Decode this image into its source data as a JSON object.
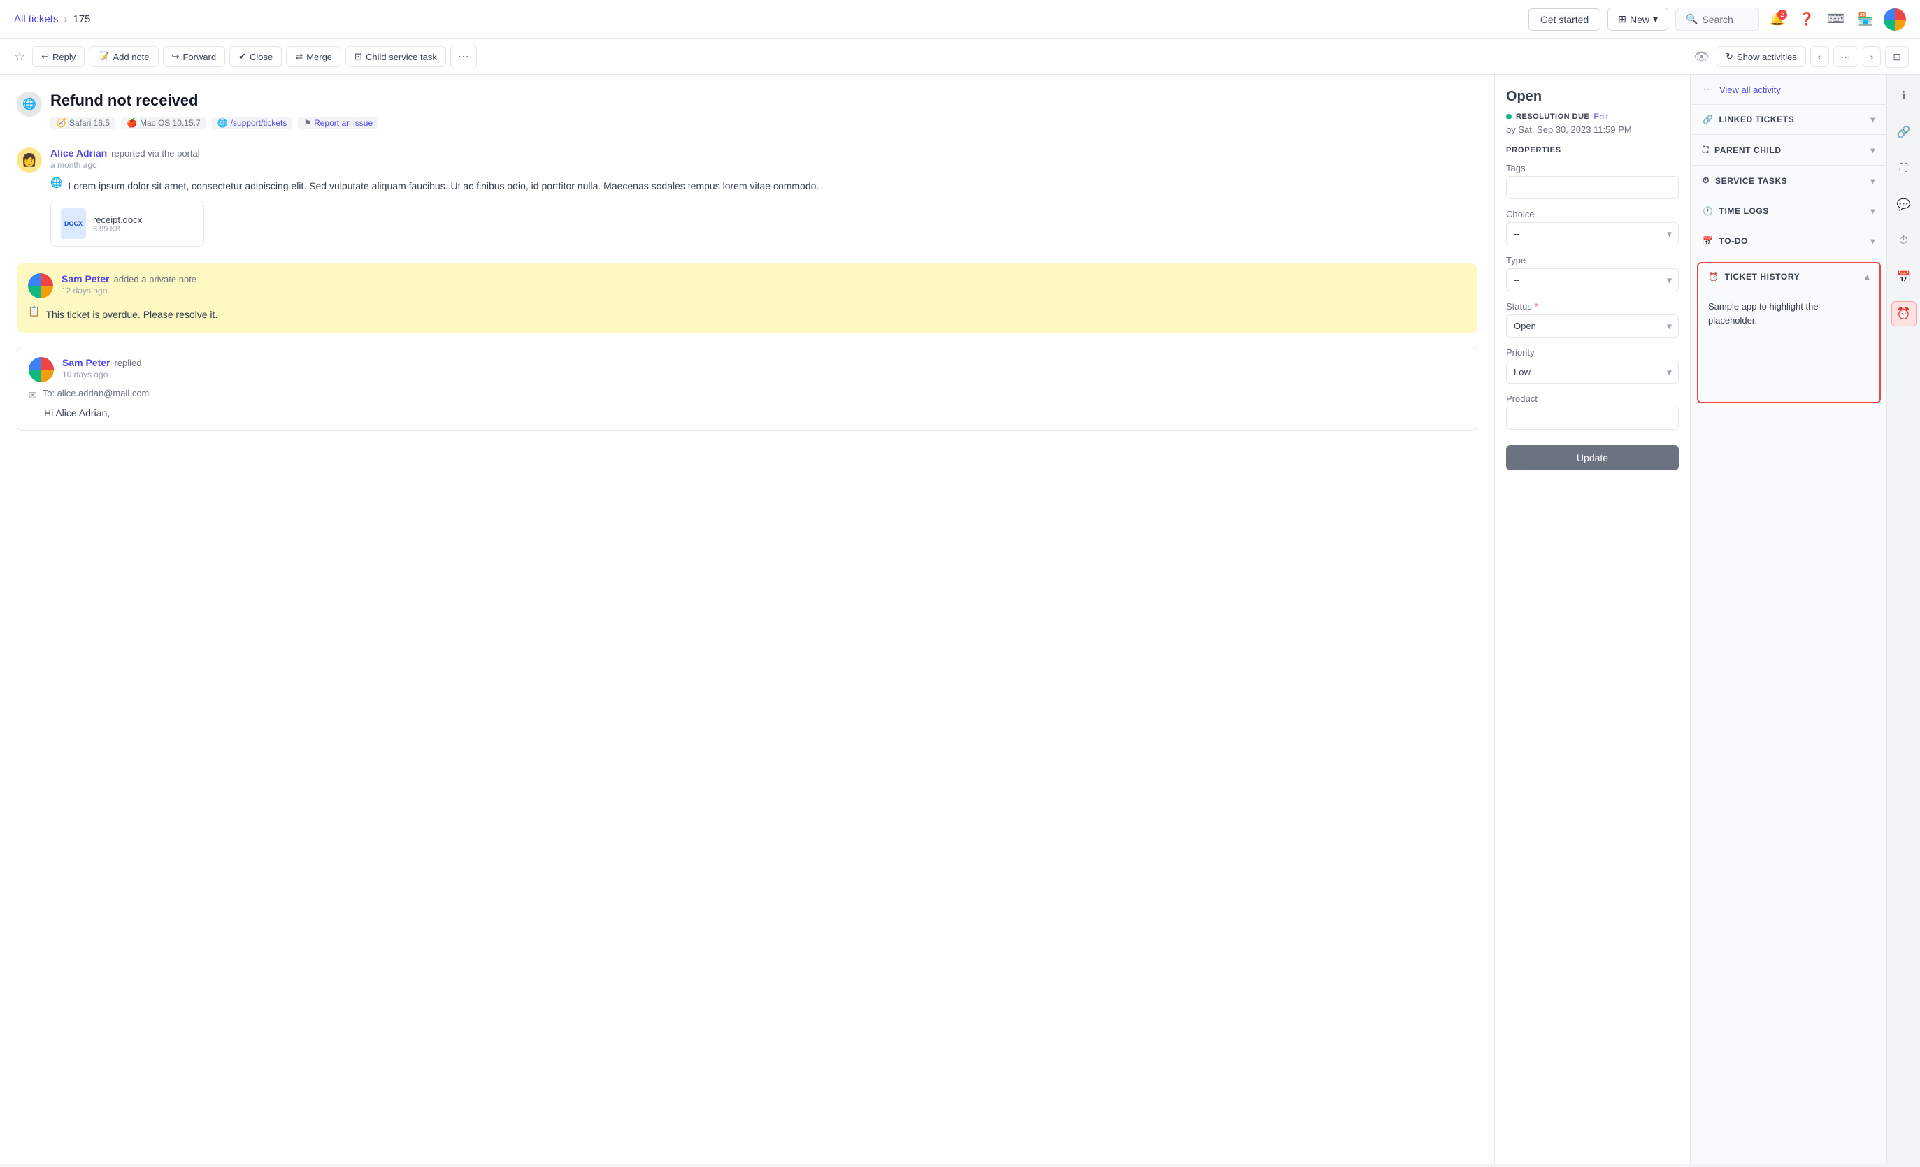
{
  "nav": {
    "breadcrumb_link": "All tickets",
    "breadcrumb_sep": "›",
    "breadcrumb_current": "175",
    "btn_get_started": "Get started",
    "btn_new": "New",
    "btn_search": "Search"
  },
  "toolbar": {
    "star_label": "★",
    "reply_label": "Reply",
    "add_note_label": "Add note",
    "forward_label": "Forward",
    "close_label": "Close",
    "merge_label": "Merge",
    "child_service_task_label": "Child service task",
    "more_label": "⋯",
    "show_activities_label": "Show activities"
  },
  "ticket": {
    "title": "Refund not received",
    "meta": {
      "browser": "Safari 16.5",
      "os": "Mac OS 10.15.7",
      "path": "/support/tickets",
      "report": "Report an issue"
    }
  },
  "messages": [
    {
      "author": "Alice Adrian",
      "action": "reported via the portal",
      "time": "a month ago",
      "text": "Lorem ipsum dolor sit amet, consectetur adipiscing elit. Sed vulputate aliquam faucibus. Ut ac finibus odio, id porttitor nulla. Maecenas sodales tempus lorem vitae commodo.",
      "attachment_name": "receipt.docx",
      "attachment_size": "8.99 KB"
    }
  ],
  "private_note": {
    "author": "Sam Peter",
    "action": "added a private note",
    "time": "12 days ago",
    "text": "This ticket is overdue. Please resolve it."
  },
  "reply": {
    "author": "Sam Peter",
    "action": "replied",
    "time": "10 days ago",
    "to": "To: alice.adrian@mail.com",
    "greeting": "Hi Alice Adrian,"
  },
  "properties": {
    "status_open": "Open",
    "resolution_label": "RESOLUTION DUE",
    "resolution_edit": "Edit",
    "resolution_date": "by Sat, Sep 30, 2023 11:59 PM",
    "section_label": "PROPERTIES",
    "tags_label": "Tags",
    "choice_label": "Choice",
    "choice_placeholder": "--",
    "type_label": "Type",
    "type_placeholder": "--",
    "status_label": "Status",
    "status_value": "Open",
    "priority_label": "Priority",
    "priority_value": "Low",
    "product_label": "Product",
    "btn_update": "Update"
  },
  "right_panel": {
    "view_all_activity": "View all activity",
    "linked_tickets": "LINKED TICKETS",
    "parent_child": "PARENT CHILD",
    "service_tasks": "SERVICE TASKS",
    "time_logs": "TIME LOGS",
    "to_do": "TO-DO",
    "ticket_history": "TICKET HISTORY",
    "history_content": "Sample app to highlight the placeholder."
  }
}
